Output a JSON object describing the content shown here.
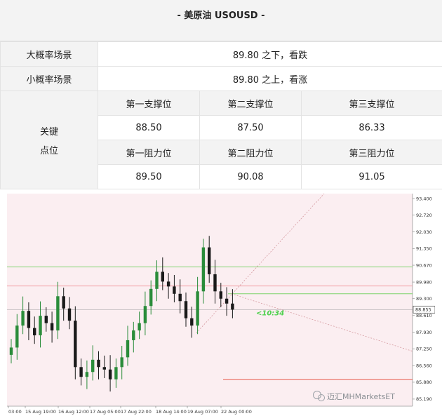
{
  "title": "-  美原油 USOUSD  -",
  "scenarios": [
    {
      "label": "大概率场景",
      "text": "89.80 之下，看跌"
    },
    {
      "label": "小概率场景",
      "text": "89.80 之上，看涨"
    }
  ],
  "key_levels": {
    "label_line1": "关键",
    "label_line2": "点位",
    "support_headers": [
      "第一支撑位",
      "第二支撑位",
      "第三支撑位"
    ],
    "support_values": [
      "88.50",
      "87.50",
      "86.33"
    ],
    "resistance_headers": [
      "第一阻力位",
      "第二阻力位",
      "第三阻力位"
    ],
    "resistance_values": [
      "89.50",
      "90.08",
      "91.05"
    ]
  },
  "chart": {
    "price_ticks": [
      "93.400",
      "92.720",
      "92.030",
      "91.350",
      "90.670",
      "89.980",
      "89.300",
      "88.610",
      "87.930",
      "87.250",
      "86.560",
      "85.880",
      "85.190"
    ],
    "current_price": "88.855",
    "countdown": "<10:34",
    "time_labels": [
      "03:00",
      "15 Aug 19:00",
      "16 Aug 12:00",
      "17 Aug 05:00",
      "17 Aug 22:00",
      "18 Aug 14:00",
      "19 Aug 07:00",
      "22 Aug 00:00"
    ],
    "watermark": "迈汇MHMarketsET",
    "colors": {
      "background": "#fbeef1",
      "up": "#2a8c3a",
      "down": "#1a1a1a",
      "green_line": "#7dd36b",
      "red_line": "#e8584b",
      "pink_line": "#f2a0a6",
      "countdown": "#4ed14e"
    }
  },
  "chart_data": {
    "type": "candlestick",
    "x": [
      "15 Aug 03:00",
      "15 Aug 19:00",
      "16 Aug 12:00",
      "17 Aug 05:00",
      "17 Aug 22:00",
      "18 Aug 14:00",
      "19 Aug 07:00",
      "22 Aug 00:00"
    ],
    "close_series": [
      87.3,
      88.2,
      88.8,
      88.1,
      87.8,
      88.6,
      88.3,
      88.0,
      89.4,
      88.9,
      88.4,
      86.5,
      86.1,
      86.3,
      86.8,
      86.5,
      86.4,
      86.0,
      86.5,
      86.9,
      87.6,
      88.0,
      88.3,
      89.0,
      89.7,
      90.4,
      90.0,
      89.8,
      89.5,
      89.2,
      88.5,
      88.2,
      89.6,
      91.4,
      90.3,
      89.6,
      89.3,
      89.1,
      88.85
    ],
    "levels": [
      {
        "value": 90.6,
        "color": "green"
      },
      {
        "value": 89.5,
        "color": "green"
      },
      {
        "value": 89.82,
        "color": "pink"
      },
      {
        "value": 86.0,
        "color": "red"
      }
    ],
    "yrange": [
      84.9,
      93.6
    ]
  }
}
